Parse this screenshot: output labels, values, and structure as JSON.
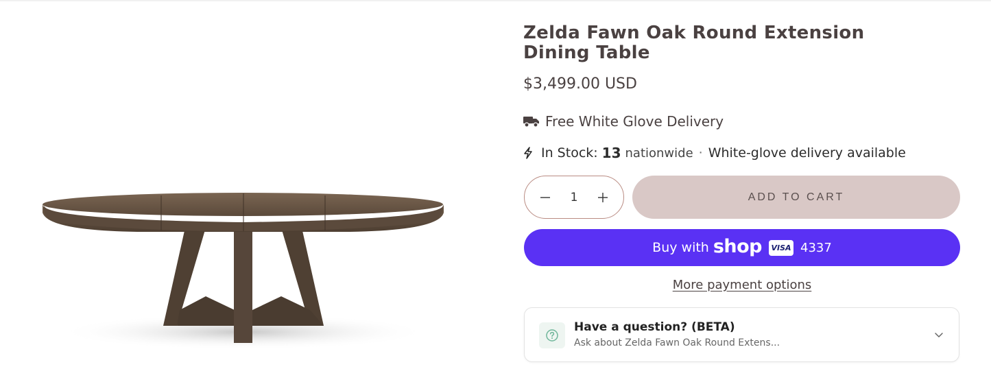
{
  "product": {
    "title": "Zelda Fawn Oak Round Extension Dining Table",
    "price": "$3,499.00 USD",
    "image_icon": "dining-table-image"
  },
  "delivery": {
    "label": "Free White Glove Delivery",
    "icon": "truck-icon"
  },
  "stock": {
    "prefix": "In Stock:",
    "count": "13",
    "suffix": "nationwide",
    "separator": "·",
    "note": "White-glove delivery available",
    "icon": "lightning-icon"
  },
  "quantity": {
    "value": "1",
    "decrease_icon": "minus-icon",
    "increase_icon": "plus-icon"
  },
  "actions": {
    "add_to_cart": "ADD TO CART",
    "buy_with": "Buy with",
    "shop_logo": "shop",
    "card_brand": "VISA",
    "card_last4": "4337",
    "more_payment": "More payment options"
  },
  "question": {
    "title": "Have a question? (BETA)",
    "subtitle": "Ask about Zelda Fawn Oak Round Extens...",
    "icon": "question-circle-icon",
    "expand_icon": "chevron-down-icon"
  },
  "colors": {
    "shop_pay": "#5a31f4",
    "add_to_cart_bg": "#d9c8c6",
    "qty_border": "#b98b82"
  }
}
